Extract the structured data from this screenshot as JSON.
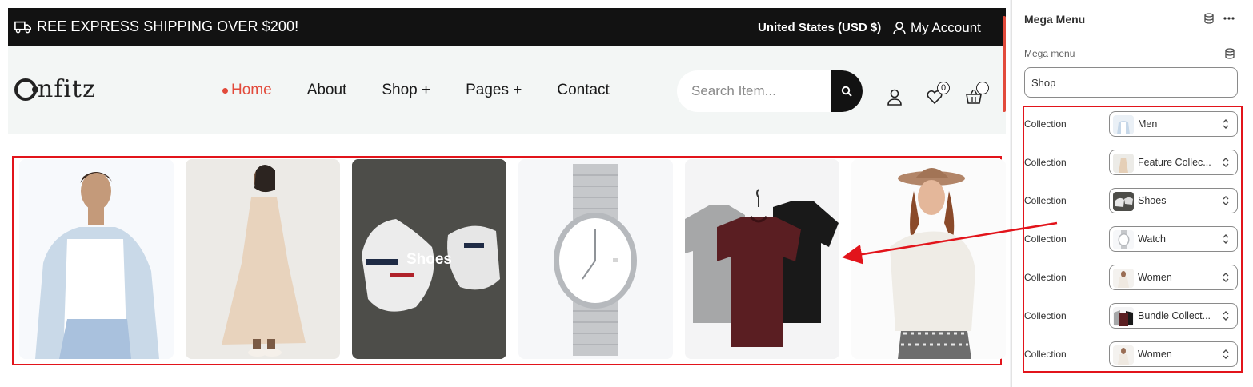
{
  "topbar": {
    "promo": "REE EXPRESS SHIPPING OVER $200!",
    "currency": "United States (USD $)",
    "account": "My Account"
  },
  "header": {
    "logo": "onfitz",
    "nav": [
      {
        "label": "Home",
        "active": true
      },
      {
        "label": "About"
      },
      {
        "label": "Shop +"
      },
      {
        "label": "Pages +"
      },
      {
        "label": "Contact"
      }
    ],
    "search_placeholder": "Search Item...",
    "wishlist_count": "0",
    "accent_color": "#e24a3b"
  },
  "cards": [
    {
      "name": "men",
      "label": ""
    },
    {
      "name": "feature-collection",
      "label": ""
    },
    {
      "name": "shoes",
      "label": "Shoes"
    },
    {
      "name": "watch",
      "label": ""
    },
    {
      "name": "bundle-collection",
      "label": ""
    },
    {
      "name": "women",
      "label": ""
    }
  ],
  "panel": {
    "title": "Mega Menu",
    "field_label": "Mega menu",
    "field_value": "Shop",
    "collections": [
      {
        "label": "Collection",
        "value": "Men"
      },
      {
        "label": "Collection",
        "value": "Feature Collec..."
      },
      {
        "label": "Collection",
        "value": "Shoes"
      },
      {
        "label": "Collection",
        "value": "Watch"
      },
      {
        "label": "Collection",
        "value": "Women"
      },
      {
        "label": "Collection",
        "value": "Bundle Collect..."
      },
      {
        "label": "Collection",
        "value": "Women"
      }
    ]
  },
  "highlight_color": "#e2141b"
}
